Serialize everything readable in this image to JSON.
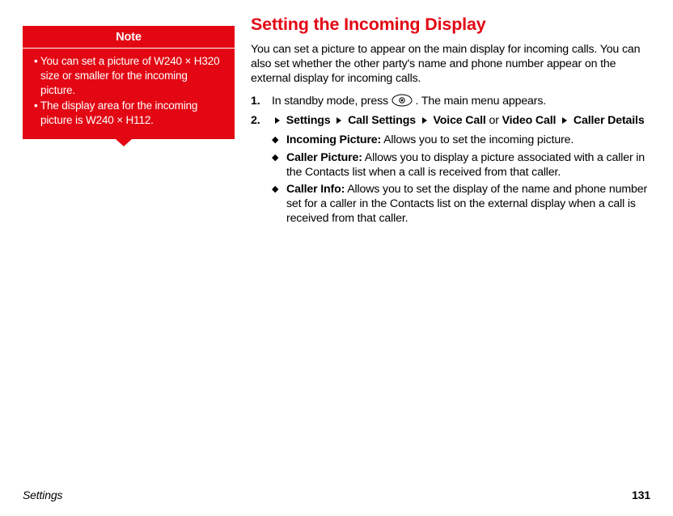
{
  "note": {
    "title": "Note",
    "items": [
      "You can set a picture of W240 × H320 size or smaller for the incoming picture.",
      "The display area for the incoming picture is W240 × H112."
    ]
  },
  "main": {
    "heading": "Setting the Incoming Display",
    "intro": "You can set a picture to appear on the main display for incoming calls. You can also set whether the other party's name and phone number appear on the external display for incoming calls.",
    "step1": {
      "num": "1.",
      "pre": "In standby mode, press ",
      "post": ". The main menu appears."
    },
    "step2": {
      "num": "2.",
      "settings": "Settings",
      "call_settings": "Call Settings",
      "voice_call": "Voice Call",
      "or": " or ",
      "video_call": "Video Call",
      "caller_details": "Caller Details"
    },
    "sub": {
      "incoming_picture_label": "Incoming Picture:",
      "incoming_picture_text": " Allows you to set the incoming picture.",
      "caller_picture_label": "Caller Picture:",
      "caller_picture_text": " Allows you to display a picture associated with a caller in the Contacts list when a call is received from that caller.",
      "caller_info_label": "Caller Info:",
      "caller_info_text": " Allows you to set the display of the name and phone number set for a caller in the Contacts list on the external display when a call is received from that caller."
    }
  },
  "footer": {
    "section": "Settings",
    "page": "131"
  }
}
